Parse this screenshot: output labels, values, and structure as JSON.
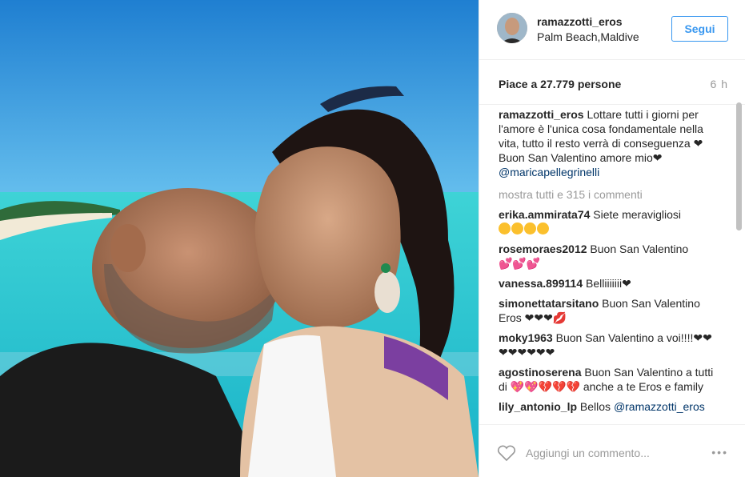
{
  "post": {
    "username": "ramazzotti_eros",
    "location": "Palm Beach,Maldive",
    "follow_label": "Segui",
    "likes": "Piace a 27.779 persone",
    "time": "6 h"
  },
  "caption": {
    "user": "ramazzotti_eros",
    "text": " Lottare tutti i giorni per l'amore è l'unica cosa fondamentale nella vita, tutto il resto verrà di conseguenza ❤ Buon San Valentino amore mio❤ ",
    "mention": "@maricapellegrinelli"
  },
  "show_all_label": "mostra tutti e 315 i commenti",
  "comments": [
    {
      "user": "erika.ammirata74",
      "text": " Siete meravigliosi"
    },
    {
      "user": "rosemoraes2012",
      "text": " Buon San Valentino"
    },
    {
      "user": "vanessa.899114",
      "text": " Belliiiiiii❤"
    },
    {
      "user": "simonettatarsitano",
      "text": " Buon San Valentino Eros ❤❤❤"
    },
    {
      "user": "moky1963",
      "text": " Buon San Valentino a voi!!!!❤❤❤❤❤❤❤❤"
    },
    {
      "user": "agostinoserena",
      "text": " Buon San Valentino a tutti di ",
      "text2": " anche a te Eros e family"
    },
    {
      "user": "lily_antonio_lp",
      "text": " Bellos ",
      "mention": "@ramazzotti_eros"
    }
  ],
  "footer": {
    "comment_placeholder": "Aggiungi un commento...",
    "more_label": "•••"
  },
  "icons": {
    "heart": "heart-outline-icon",
    "more": "more-options-icon"
  },
  "colors": {
    "link": "#3897f0",
    "text": "#262626",
    "muted": "#999999",
    "mention": "#003569"
  }
}
